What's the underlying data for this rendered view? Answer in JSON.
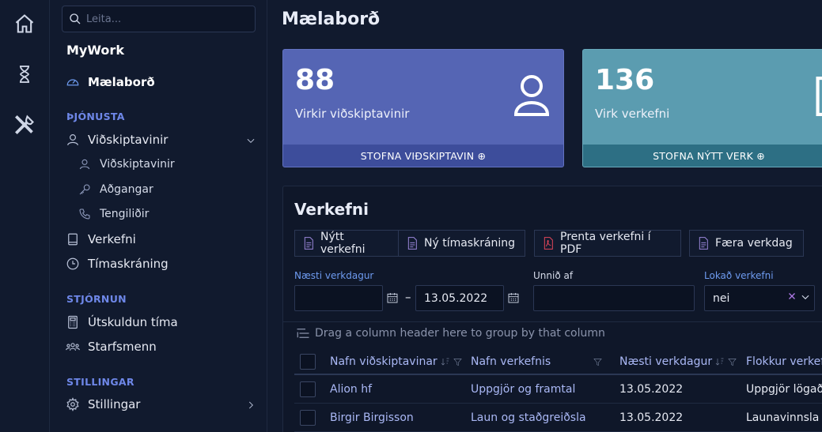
{
  "search": {
    "placeholder": "Leita..."
  },
  "sidebar": {
    "title": "MyWork",
    "dashboard": "Mælaborð",
    "sections": {
      "service": "ÞJÓNUSTA",
      "management": "STJÓRNUN",
      "settings": "STILLINGAR"
    },
    "customers_group": "Viðskiptavinir",
    "customers_sub": [
      "Viðskiptavinir",
      "Aðgangar",
      "Tengiliðir"
    ],
    "projects": "Verkefni",
    "time_registration": "Tímaskráning",
    "time_owed": "Útskuldun tíma",
    "staff": "Starfsmenn",
    "settings_item": "Stillingar"
  },
  "main": {
    "title": "Mælaborð",
    "cards": [
      {
        "value": "88",
        "label": "Virkir viðskiptavinir",
        "action": "STOFNA VIÐSKIPTAVIN ⊕",
        "color": "#5565b4"
      },
      {
        "value": "136",
        "label": "Virk verkefni",
        "action": "STOFNA NÝTT VERK ⊕",
        "color": "#5b9cb0"
      }
    ]
  },
  "projects_panel": {
    "title": "Verkefni",
    "buttons": [
      "Nýtt verkefni",
      "Ný tímaskráning",
      "Prenta verkefni í PDF",
      "Færa verkdag"
    ],
    "filters": {
      "next_workday_label": "Næsti verkdagur",
      "date_from": "",
      "date_to": "13.05.2022",
      "worked_by_label": "Unnið af",
      "worked_by": "",
      "closed_label": "Lokað verkefni",
      "closed_value": "nei"
    },
    "group_hint": "Drag a column header here to group by that column",
    "columns": [
      "Nafn viðskiptavinar",
      "Nafn verkefnis",
      "Næsti verkdagur",
      "Flokkur verkef"
    ],
    "rows": [
      {
        "customer": "Alion hf",
        "project": "Uppgjör og framtal",
        "next": "13.05.2022",
        "category": "Uppgjör lögaði"
      },
      {
        "customer": "Birgir Birgisson",
        "project": "Laun og staðgreiðsla",
        "next": "13.05.2022",
        "category": "Launavinnsla"
      }
    ]
  }
}
